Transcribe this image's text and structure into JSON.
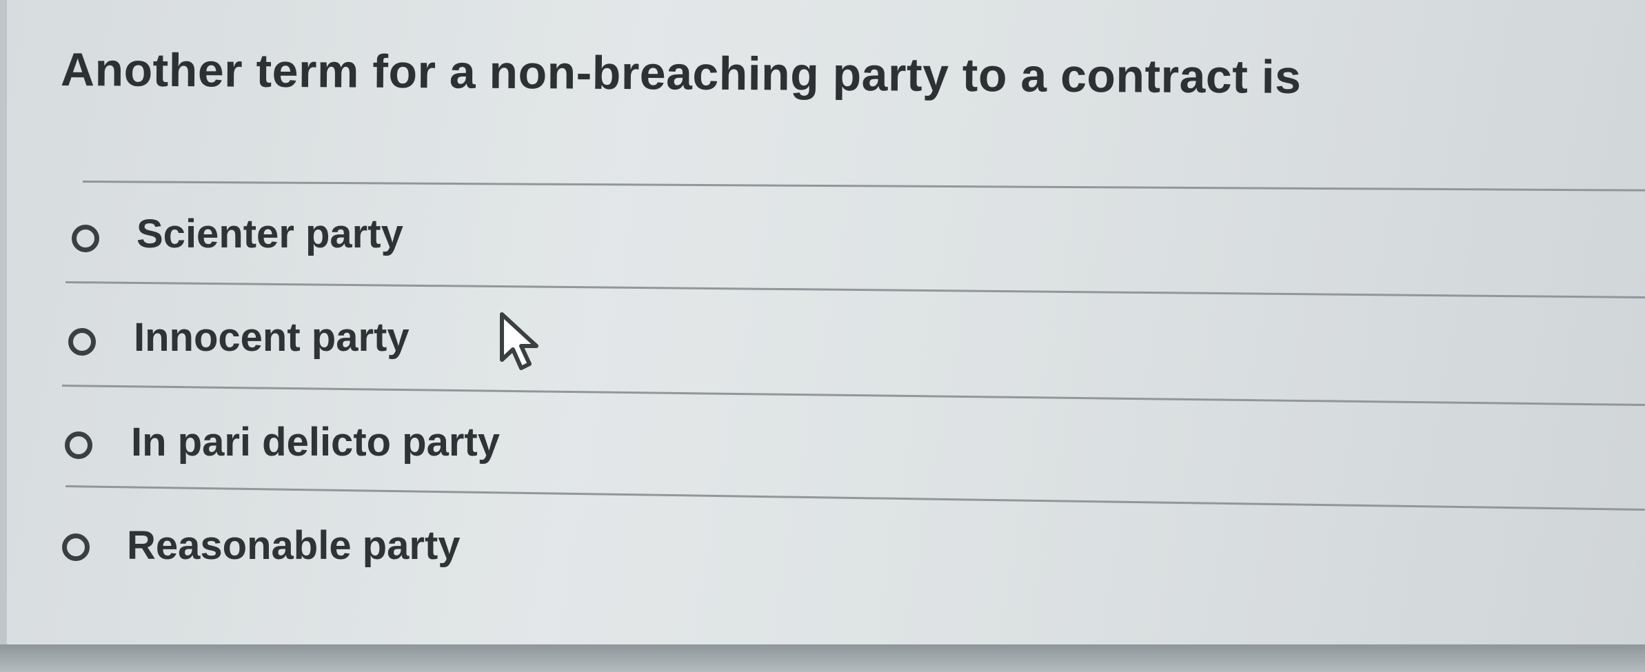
{
  "question": {
    "text": "Another term for a non-breaching party to a contract is"
  },
  "options": [
    {
      "label": "Scienter party",
      "selected": false
    },
    {
      "label": "Innocent party",
      "selected": false
    },
    {
      "label": "In pari delicto party",
      "selected": false
    },
    {
      "label": "Reasonable party",
      "selected": false
    }
  ],
  "icons": {
    "radio": "radio-button-unselected",
    "cursor": "mouse-pointer-arrow"
  },
  "colors": {
    "text": "#2d3134",
    "divider": "#8f979b",
    "background": "#dde2e3"
  }
}
